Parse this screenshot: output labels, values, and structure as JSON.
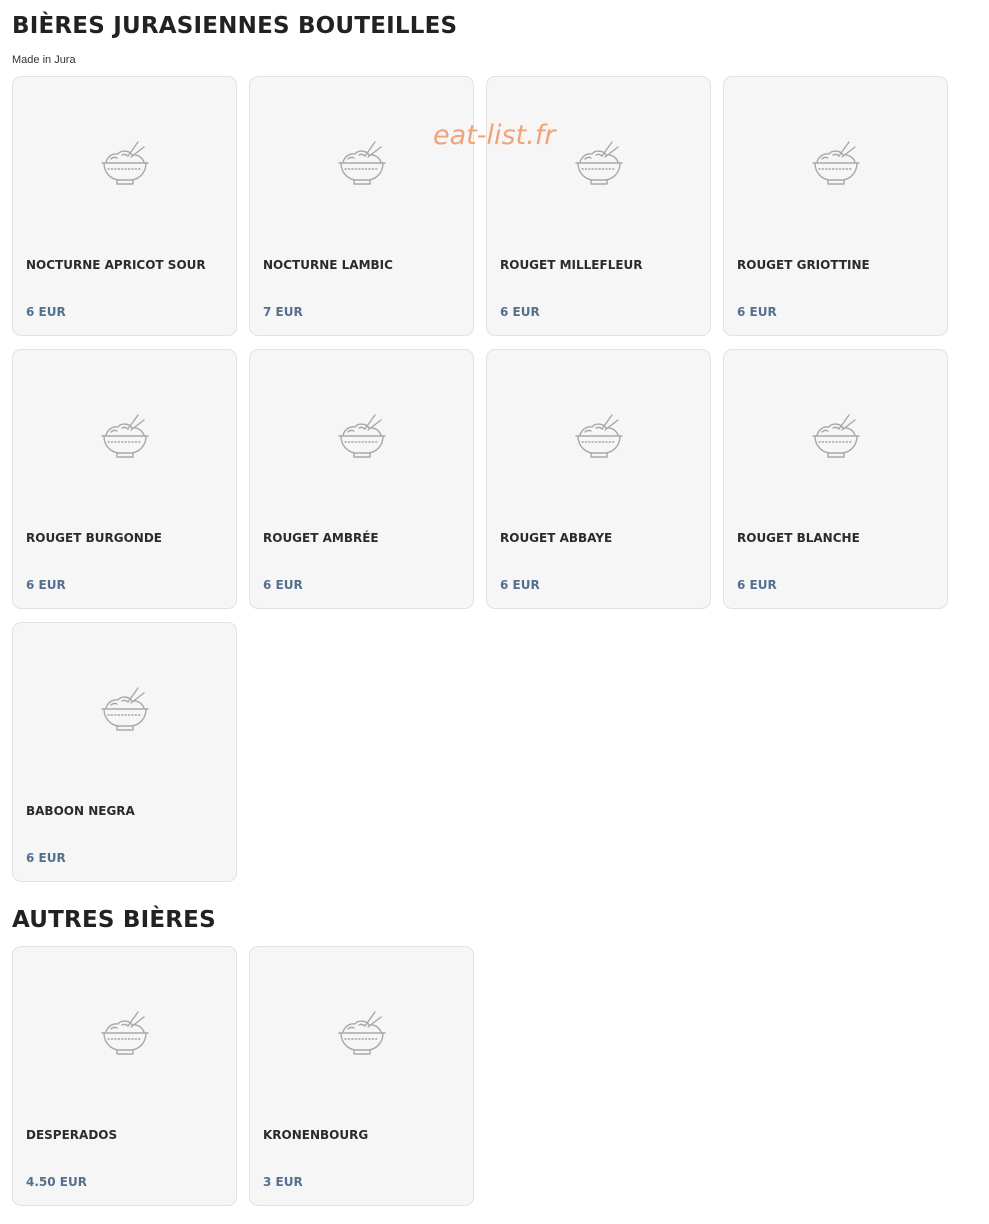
{
  "watermark": "eat-list.fr",
  "colors": {
    "price": "#54708e",
    "card_background": "#f6f6f6",
    "watermark": "#f0a37a"
  },
  "placeholder_icon": "rice-bowl-icon",
  "sections": [
    {
      "title": "BIÈRES JURASIENNES BOUTEILLES",
      "subtitle": "Made in Jura",
      "items": [
        {
          "name": "NOCTURNE APRICOT SOUR",
          "price": "6 EUR"
        },
        {
          "name": "NOCTURNE LAMBIC",
          "price": "7 EUR"
        },
        {
          "name": "ROUGET MILLEFLEUR",
          "price": "6 EUR"
        },
        {
          "name": "ROUGET GRIOTTINE",
          "price": "6 EUR"
        },
        {
          "name": "ROUGET BURGONDE",
          "price": "6 EUR"
        },
        {
          "name": "ROUGET AMBRÉE",
          "price": "6 EUR"
        },
        {
          "name": "ROUGET ABBAYE",
          "price": "6 EUR"
        },
        {
          "name": "ROUGET BLANCHE",
          "price": "6 EUR"
        },
        {
          "name": "BABOON NEGRA",
          "price": "6 EUR"
        }
      ]
    },
    {
      "title": "AUTRES BIÈRES",
      "items": [
        {
          "name": "DESPERADOS",
          "price": "4.50 EUR"
        },
        {
          "name": "KRONENBOURG",
          "price": "3 EUR"
        }
      ]
    }
  ]
}
